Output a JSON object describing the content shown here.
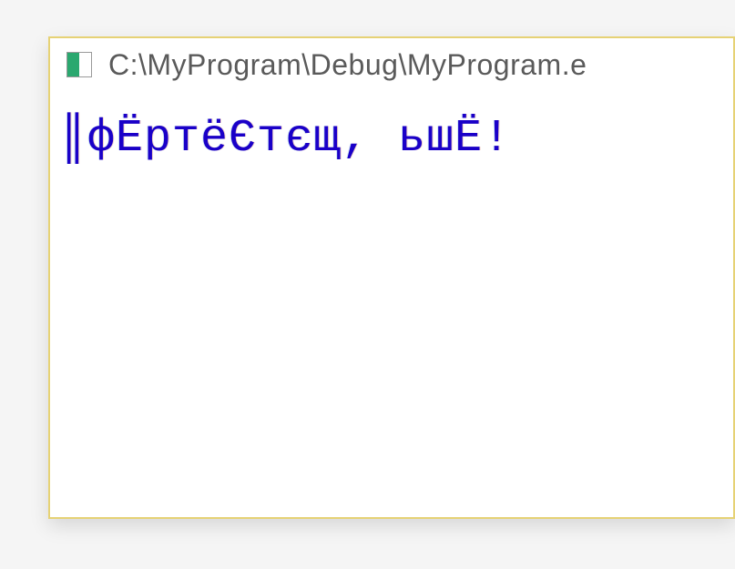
{
  "window": {
    "title": "C:\\MyProgram\\Debug\\MyProgram.e",
    "icon": "console-app-icon"
  },
  "console": {
    "output": "║фЁртёЄтєщ, ьшЁ!"
  }
}
